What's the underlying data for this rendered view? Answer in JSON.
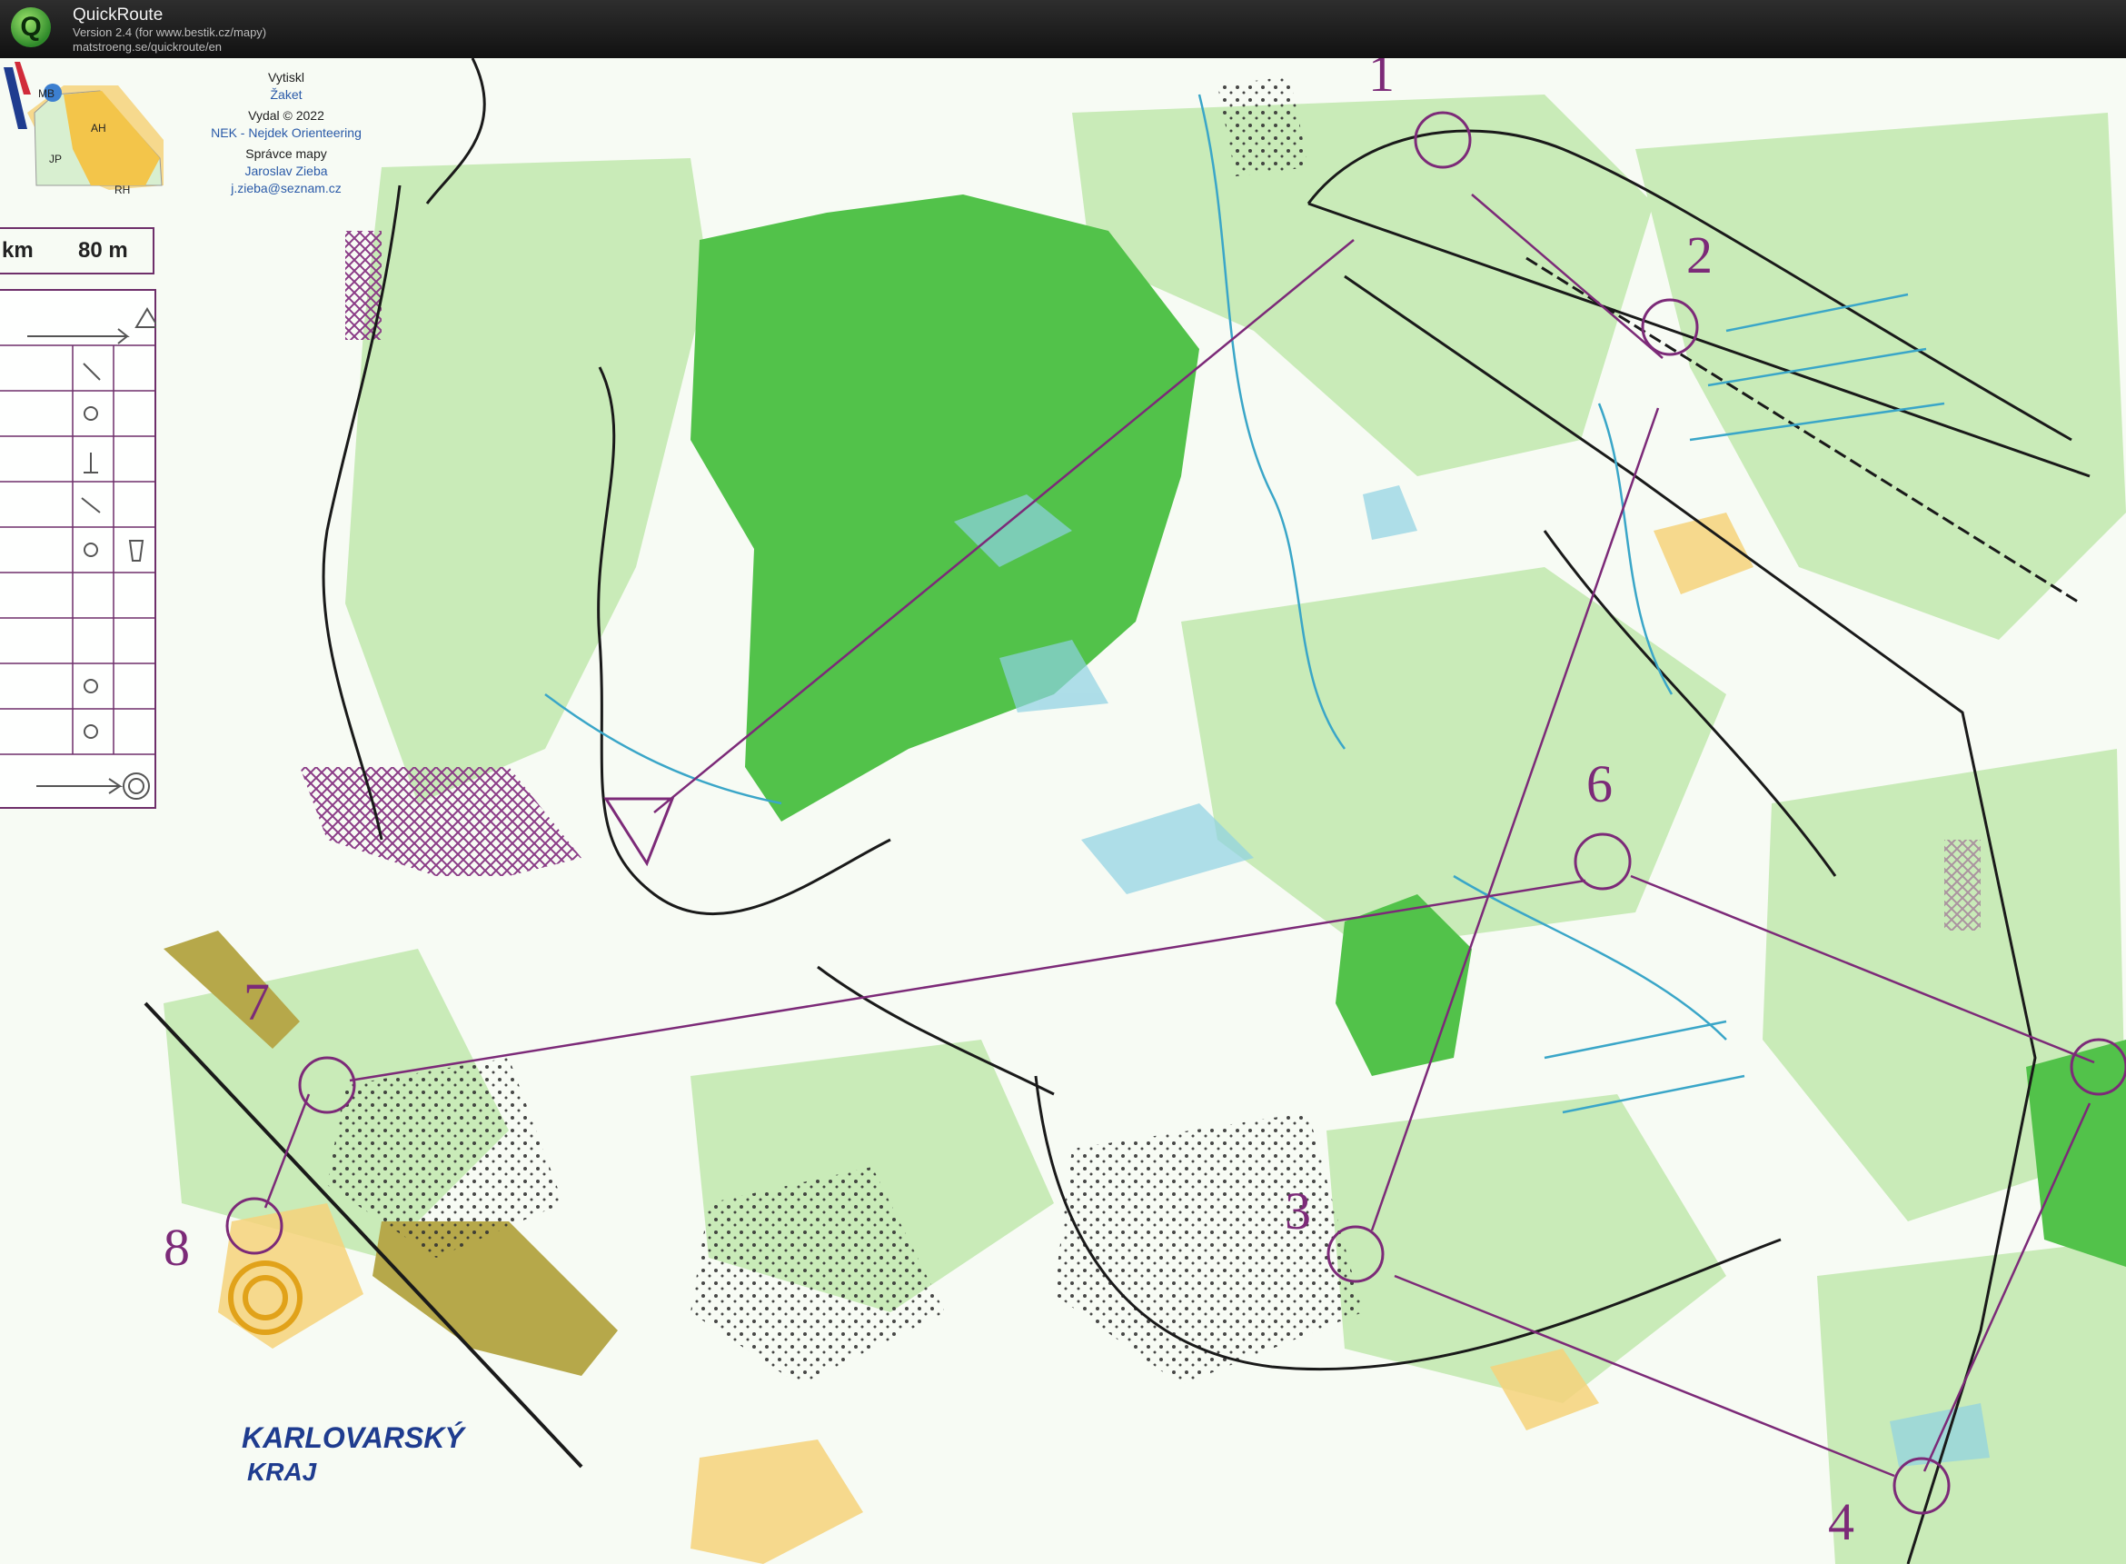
{
  "app": {
    "name": "QuickRoute",
    "version": "Version 2.4  (for www.bestik.cz/mapy)",
    "url": "matstroeng.se/quickroute/en",
    "logo_letter": "Q"
  },
  "map": {
    "overview": {
      "labels": [
        "MB",
        "AH",
        "JP",
        "RH"
      ]
    },
    "credits": {
      "printed_label": "Vytiskl",
      "printer": "Žaket",
      "published_label": "Vydal © 2022",
      "publisher": "NEK - Nejdek Orienteering",
      "admin_label": "Správce mapy",
      "admin_name": "Jaroslav Zieba",
      "admin_email": "j.zieba@seznam.cz"
    },
    "scale": {
      "left": "km",
      "right": "80 m"
    },
    "controls": [
      {
        "number": "1"
      },
      {
        "number": "2"
      },
      {
        "number": "3"
      },
      {
        "number": "4"
      },
      {
        "number": "6"
      },
      {
        "number": "7"
      },
      {
        "number": "8"
      }
    ],
    "sponsor": {
      "line1": "KARLOVARSKÝ",
      "line2": "KRAJ"
    },
    "colors": {
      "course": "#7c2a78",
      "forest_dark": "#4cc145",
      "forest_light": "#b9e6a6",
      "open_land": "#f4c55a",
      "water": "#6fc2d8",
      "track": "#1a1a1a"
    }
  }
}
